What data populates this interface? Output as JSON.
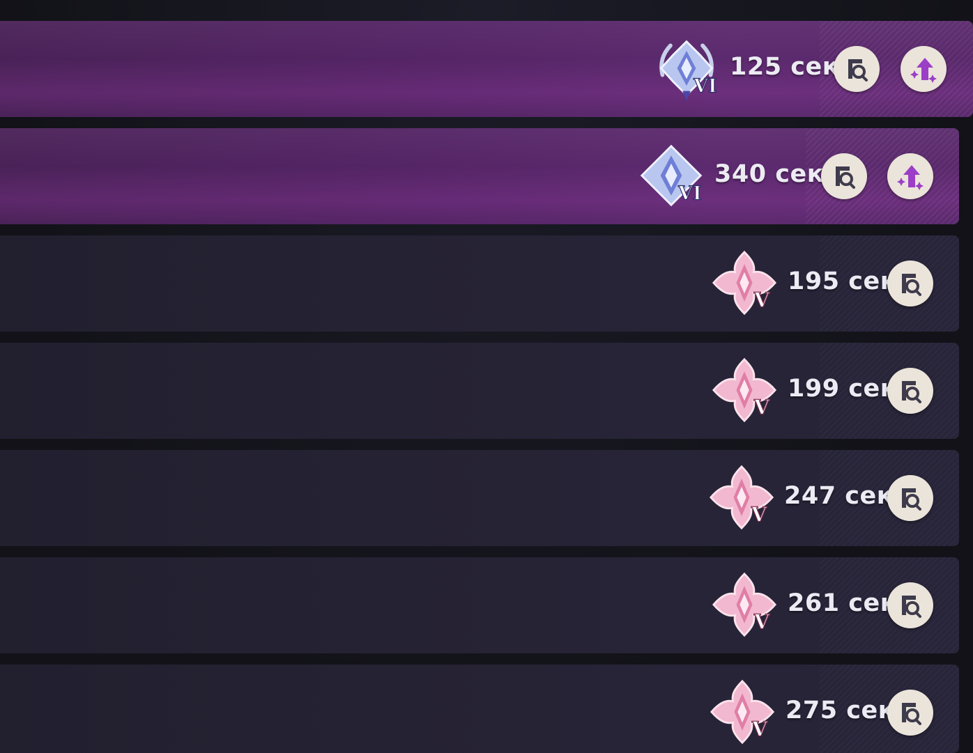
{
  "colors": {
    "highlight_row": "#552566",
    "normal_row": "#262335",
    "button_bg": "#ebe4da",
    "icon_dark": "#3e3b4c",
    "upgrade_icon": "#9b3fc7",
    "time_text": "#ecebf3"
  },
  "rows": [
    {
      "style": "purple",
      "tier": "VI",
      "medal": "silver-laurel-medal-icon",
      "time": "125 сек.",
      "has_upgrade": true
    },
    {
      "style": "purple",
      "tier": "VI",
      "medal": "silver-medal-icon",
      "time": "340 сек.",
      "has_upgrade": true
    },
    {
      "style": "dark",
      "tier": "V",
      "medal": "pink-flower-medal-icon",
      "time": "195 сек.",
      "has_upgrade": false
    },
    {
      "style": "dark",
      "tier": "V",
      "medal": "pink-flower-medal-icon",
      "time": "199 сек.",
      "has_upgrade": false
    },
    {
      "style": "dark",
      "tier": "V",
      "medal": "pink-flower-medal-icon",
      "time": "247 сек.",
      "has_upgrade": false
    },
    {
      "style": "dark",
      "tier": "V",
      "medal": "pink-flower-medal-icon",
      "time": "261 сек.",
      "has_upgrade": false
    },
    {
      "style": "dark",
      "tier": "V",
      "medal": "pink-flower-medal-icon",
      "time": "275 сек.",
      "has_upgrade": false
    }
  ],
  "icons": {
    "view": "view-details-icon",
    "upgrade": "upgrade-arrow-icon"
  }
}
